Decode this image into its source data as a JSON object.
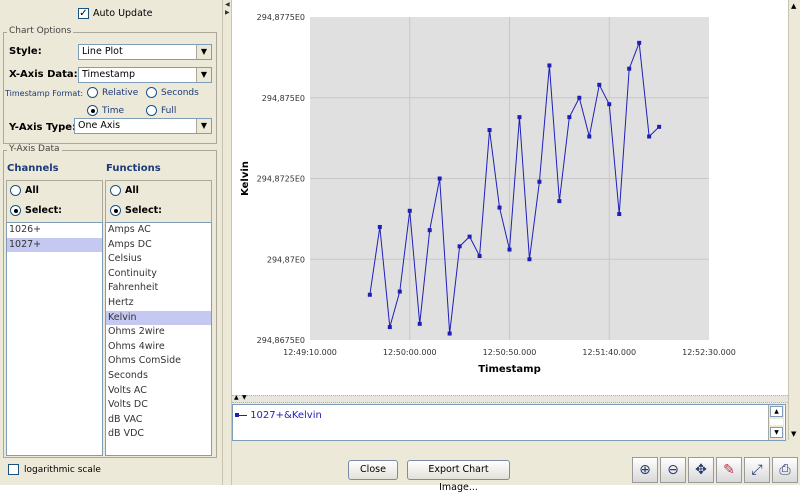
{
  "controls": {
    "auto_update_label": "Auto Update",
    "chart_options_title": "Chart Options",
    "style_label": "Style:",
    "style_value": "Line Plot",
    "xaxis_label": "X-Axis Data:",
    "xaxis_value": "Timestamp",
    "timestamp_format_label": "Timestamp Format:",
    "relative_label": "Relative",
    "seconds_label": "Seconds",
    "time_label": "Time",
    "full_label": "Full",
    "yaxis_type_label": "Y-Axis Type:",
    "yaxis_type_value": "One Axis",
    "yaxis_data_title": "Y-Axis Data",
    "channels_header": "Channels",
    "functions_header": "Functions",
    "all_label": "All",
    "select_label": "Select:",
    "log_scale_label": "logarithmic scale"
  },
  "channels": [
    "1026+",
    "1027+"
  ],
  "functions": [
    "Amps AC",
    "Amps DC",
    "Celsius",
    "Continuity",
    "Fahrenheit",
    "Hertz",
    "Kelvin",
    "Ohms 2wire",
    "Ohms 4wire",
    "Ohms ComSide",
    "Seconds",
    "Volts AC",
    "Volts DC",
    "dB VAC",
    "dB VDC"
  ],
  "selected_channel_index": 1,
  "selected_function_index": 6,
  "buttons": {
    "close": "Close",
    "export": "Export Chart Image..."
  },
  "toolbar_icons": [
    "zoom-in-icon",
    "zoom-out-icon",
    "pan-icon",
    "eraser-icon",
    "fit-icon",
    "print-icon"
  ],
  "colors": {
    "series": "#1f1fb8",
    "plot_bg": "#e0e0e0",
    "selection": "#c5c8f0"
  },
  "chart_data": {
    "type": "line",
    "xlabel": "Timestamp",
    "ylabel": "Kelvin",
    "x_ticks": [
      "12:49:10.000",
      "12:50:00.000",
      "12:50:50.000",
      "12:51:40.000",
      "12:52:30.000"
    ],
    "y_ticks": [
      "294,8675E0",
      "294,87E0",
      "294,8725E0",
      "294,875E0",
      "294,8775E0"
    ],
    "xlim_seconds": [
      0,
      200
    ],
    "ylim": [
      294.8675,
      294.8775
    ],
    "series": [
      {
        "name": "1027+&Kelvin",
        "x_seconds": [
          30,
          35,
          40,
          45,
          50,
          55,
          60,
          65,
          70,
          75,
          80,
          85,
          90,
          95,
          100,
          105,
          110,
          115,
          120,
          125,
          130,
          135,
          140,
          145,
          150,
          155,
          160,
          165,
          170,
          175,
          180
        ],
        "y": [
          294.8689,
          294.871,
          294.8679,
          294.869,
          294.8715,
          294.868,
          294.8709,
          294.8725,
          294.8677,
          294.8704,
          294.8707,
          294.8701,
          294.874,
          294.8716,
          294.8703,
          294.8744,
          294.87,
          294.8724,
          294.876,
          294.8718,
          294.8744,
          294.875,
          294.8738,
          294.8754,
          294.8748,
          294.8714,
          294.8759,
          294.8767,
          294.8738,
          294.8741
        ]
      }
    ]
  }
}
